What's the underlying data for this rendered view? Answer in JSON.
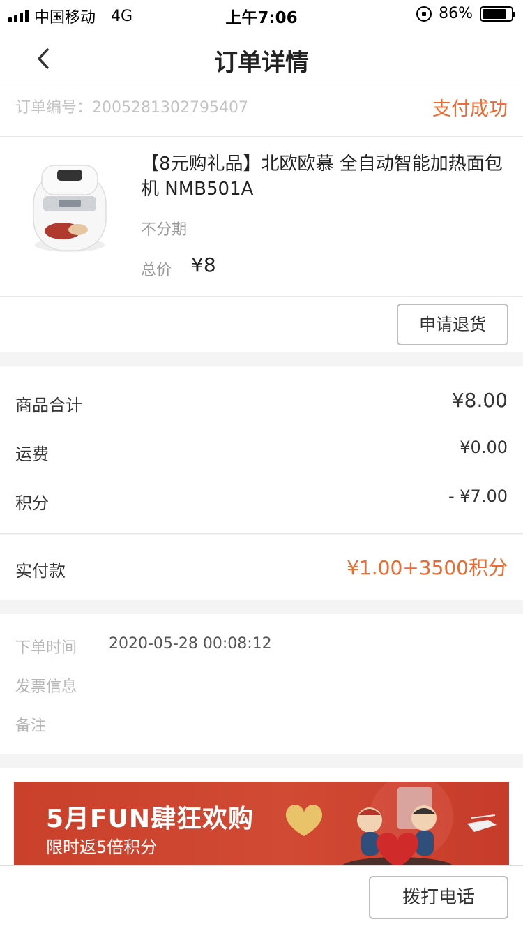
{
  "status_bar": {
    "carrier": "中国移动",
    "network": "4G",
    "time": "上午7:06",
    "battery": "86%",
    "battery_level": 0.86
  },
  "nav": {
    "title": "订单详情"
  },
  "order": {
    "number_label": "订单编号：2005281302795407",
    "status": "支付成功"
  },
  "product": {
    "title": "【8元购礼品】北欧欧慕 全自动智能加热面包机 NMB501A",
    "plan": "不分期",
    "total_label": "总价",
    "total": "¥8"
  },
  "refund_button": "申请退货",
  "summary": {
    "rows": [
      {
        "label": "商品合计",
        "value": "¥8.00"
      },
      {
        "label": "运费",
        "value": "¥0.00"
      },
      {
        "label": "积分",
        "value": "- ¥7.00"
      }
    ],
    "paid_label": "实付款",
    "paid_value": "¥1.00+3500积分"
  },
  "info": {
    "order_time_label": "下单时间",
    "order_time": "2020-05-28 00:08:12",
    "invoice_label": "发票信息",
    "remark_label": "备注"
  },
  "banner": {
    "title": "5月FUN肆狂欢购",
    "subtitle": "限时返5倍积分"
  },
  "call_button": "拨打电话",
  "colors": {
    "accent": "#f0692e",
    "banner": "#c9402b"
  }
}
